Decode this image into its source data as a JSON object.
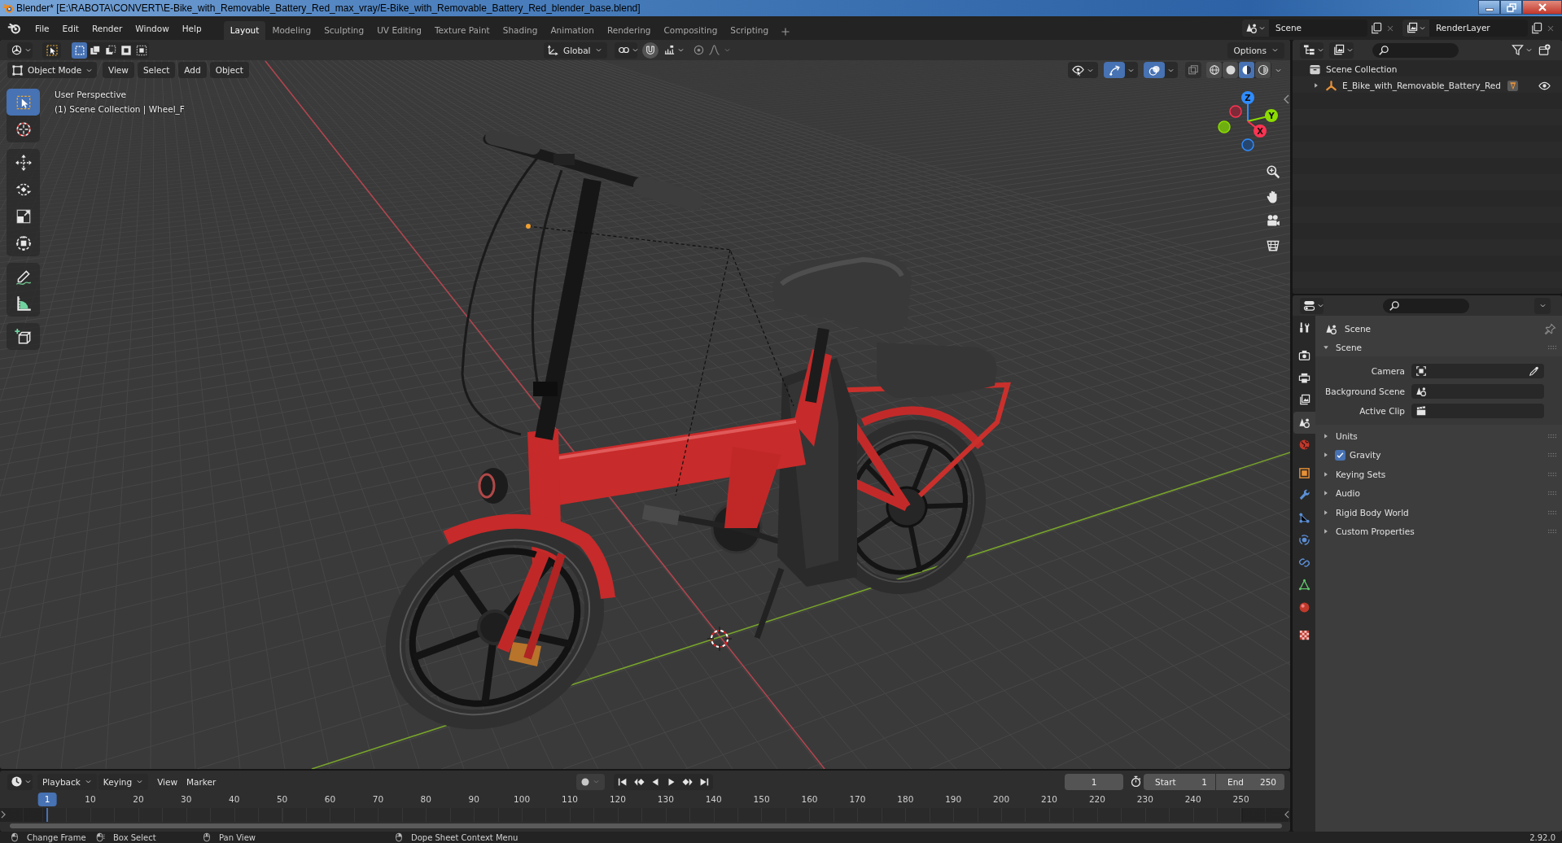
{
  "window": {
    "title": "Blender* [E:\\RABOTA\\CONVERT\\E-Bike_with_Removable_Battery_Red_max_vray/E-Bike_with_Removable_Battery_Red_blender_base.blend]"
  },
  "top_bar": {
    "menus": [
      "File",
      "Edit",
      "Render",
      "Window",
      "Help"
    ],
    "workspaces": [
      {
        "label": "Layout",
        "selected": true
      },
      {
        "label": "Modeling",
        "selected": false
      },
      {
        "label": "Sculpting",
        "selected": false
      },
      {
        "label": "UV Editing",
        "selected": false
      },
      {
        "label": "Texture Paint",
        "selected": false
      },
      {
        "label": "Shading",
        "selected": false
      },
      {
        "label": "Animation",
        "selected": false
      },
      {
        "label": "Rendering",
        "selected": false
      },
      {
        "label": "Compositing",
        "selected": false
      },
      {
        "label": "Scripting",
        "selected": false
      }
    ],
    "scene": "Scene",
    "view_layer": "RenderLayer"
  },
  "tool_header": {
    "select_modes": [
      {
        "selected": true
      },
      {
        "selected": false
      },
      {
        "selected": false
      },
      {
        "selected": false
      },
      {
        "selected": false
      }
    ],
    "orientation": "Global",
    "options": "Options"
  },
  "viewport_header": {
    "mode": "Object Mode",
    "menus": [
      "View",
      "Select",
      "Add",
      "Object"
    ],
    "show_gizmos": true,
    "show_overlays": true,
    "xray": false,
    "shading_modes": [
      {
        "selected": false
      },
      {
        "selected": false
      },
      {
        "selected": true
      },
      {
        "selected": false
      }
    ]
  },
  "viewport": {
    "view_name": "User Perspective",
    "object_info": "(1) Scene Collection | Wheel_F",
    "tools": [
      {
        "selected": true
      },
      {
        "selected": false
      },
      {
        "selected": false
      },
      {
        "selected": false
      },
      {
        "selected": false
      },
      {
        "selected": false
      },
      {
        "selected": false
      },
      {
        "selected": false
      },
      {
        "selected": false
      }
    ],
    "gizmo_axes": [
      "Z",
      "Y",
      "X"
    ]
  },
  "outliner": {
    "root": "Scene Collection",
    "items": [
      {
        "label": "E_Bike_with_Removable_Battery_Red",
        "expanded": false,
        "visible": true
      }
    ]
  },
  "properties": {
    "tabs": [
      {
        "selected": false
      },
      {
        "selected": false
      },
      {
        "selected": false
      },
      {
        "selected": false
      },
      {
        "selected": true
      },
      {
        "selected": false
      },
      {
        "selected": false
      },
      {
        "selected": false
      },
      {
        "selected": false
      },
      {
        "selected": false
      },
      {
        "selected": false
      },
      {
        "selected": false
      },
      {
        "selected": false
      },
      {
        "selected": false
      }
    ],
    "context": "Scene",
    "panels": [
      {
        "title": "Scene",
        "kind": "plain",
        "expanded": true,
        "fields": [
          {
            "label": "Camera"
          },
          {
            "label": "Background Scene"
          },
          {
            "label": "Active Clip"
          }
        ]
      },
      {
        "title": "Units",
        "kind": "plain",
        "expanded": false
      },
      {
        "title": "Gravity",
        "kind": "toggle",
        "expanded": false,
        "checked": true
      },
      {
        "title": "Keying Sets",
        "kind": "plain",
        "expanded": false
      },
      {
        "title": "Audio",
        "kind": "plain",
        "expanded": false
      },
      {
        "title": "Rigid Body World",
        "kind": "plain",
        "expanded": false
      },
      {
        "title": "Custom Properties",
        "kind": "plain",
        "expanded": false
      }
    ]
  },
  "timeline": {
    "editor_menus": [
      {
        "label": "Playback",
        "kind": "dropdown"
      },
      {
        "label": "Keying",
        "kind": "dropdown"
      },
      {
        "label": "View",
        "kind": "menu"
      },
      {
        "label": "Marker",
        "kind": "menu"
      }
    ],
    "auto_keying": false,
    "current_frame": "1",
    "start": {
      "label": "Start",
      "value": "1"
    },
    "end": {
      "label": "End",
      "value": "250"
    },
    "ruler": [
      {
        "label": "1",
        "selected": true
      },
      {
        "label": "10",
        "selected": false
      },
      {
        "label": "20",
        "selected": false
      },
      {
        "label": "30",
        "selected": false
      },
      {
        "label": "40",
        "selected": false
      },
      {
        "label": "50",
        "selected": false
      },
      {
        "label": "60",
        "selected": false
      },
      {
        "label": "70",
        "selected": false
      },
      {
        "label": "80",
        "selected": false
      },
      {
        "label": "90",
        "selected": false
      },
      {
        "label": "100",
        "selected": false
      },
      {
        "label": "110",
        "selected": false
      },
      {
        "label": "120",
        "selected": false
      },
      {
        "label": "130",
        "selected": false
      },
      {
        "label": "140",
        "selected": false
      },
      {
        "label": "150",
        "selected": false
      },
      {
        "label": "160",
        "selected": false
      },
      {
        "label": "170",
        "selected": false
      },
      {
        "label": "180",
        "selected": false
      },
      {
        "label": "190",
        "selected": false
      },
      {
        "label": "200",
        "selected": false
      },
      {
        "label": "210",
        "selected": false
      },
      {
        "label": "220",
        "selected": false
      },
      {
        "label": "230",
        "selected": false
      },
      {
        "label": "240",
        "selected": false
      },
      {
        "label": "250",
        "selected": false
      }
    ]
  },
  "status_bar": {
    "hints": [
      "Change Frame",
      "Box Select",
      "Pan View",
      "Dope Sheet Context Menu"
    ],
    "version": "2.92.0"
  }
}
